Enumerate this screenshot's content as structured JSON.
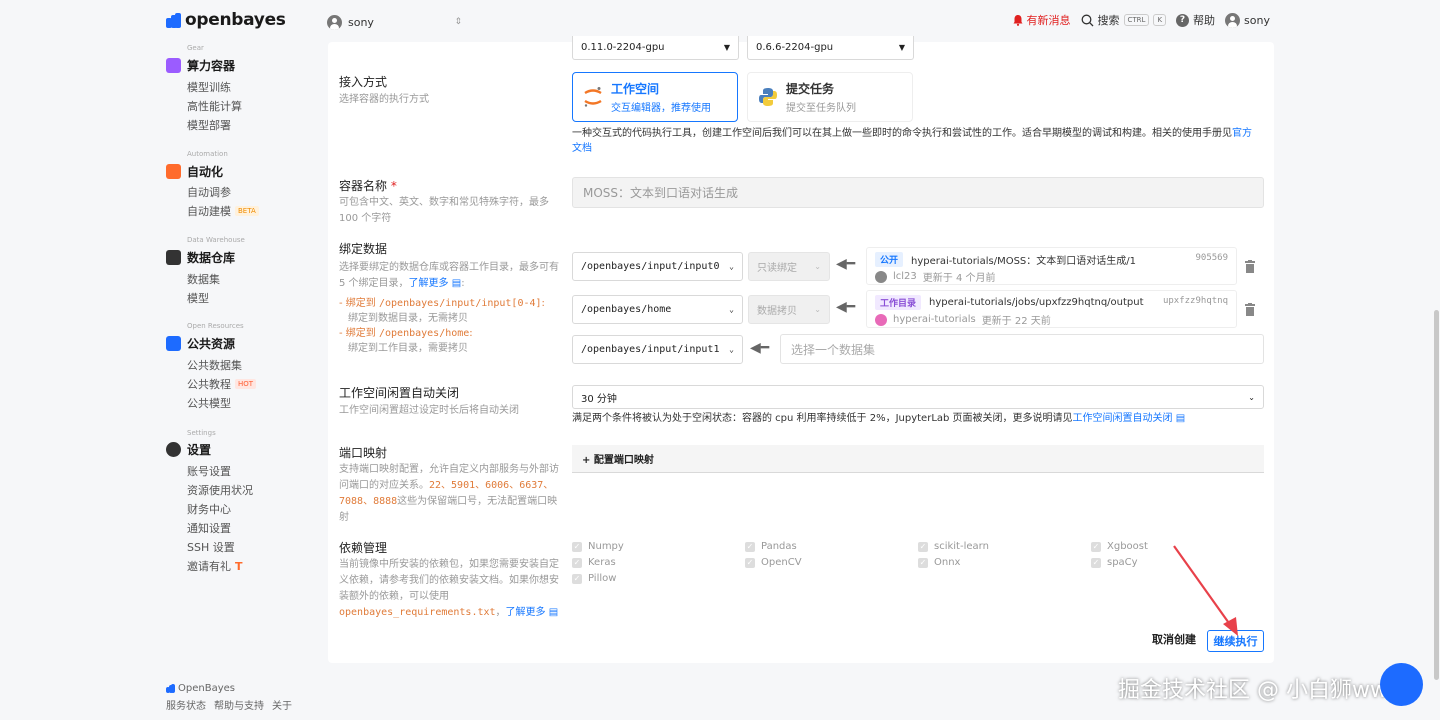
{
  "header": {
    "brand": "openbayes",
    "account": "sony",
    "notice": "有新消息",
    "search": "搜索",
    "kbd_ctrl": "CTRL",
    "kbd_k": "K",
    "help": "帮助",
    "user": "sony"
  },
  "sidebar": {
    "sections": [
      {
        "en": "Gear",
        "title": "算力容器",
        "items": [
          "模型训练",
          "高性能计算",
          "模型部署"
        ],
        "color": "#9b5cff"
      },
      {
        "en": "Automation",
        "title": "自动化",
        "items": [
          "自动调参",
          "自动建模"
        ],
        "badge": "BETA",
        "color": "#ff6b2c"
      },
      {
        "en": "Data Warehouse",
        "title": "数据仓库",
        "items": [
          "数据集",
          "模型"
        ],
        "color": "#333333"
      },
      {
        "en": "Open Resources",
        "title": "公共资源",
        "items": [
          "公共数据集",
          "公共教程",
          "公共模型"
        ],
        "badge": "HOT",
        "color": "#1d6bff"
      },
      {
        "en": "Settings",
        "title": "设置",
        "items": [
          "账号设置",
          "资源使用状况",
          "财务中心",
          "通知设置",
          "SSH 设置",
          "邀请有礼"
        ],
        "color": "#333333"
      }
    ]
  },
  "footer": {
    "brand": "OpenBayes",
    "links": [
      "服务状态",
      "帮助与支持",
      "关于"
    ]
  },
  "form": {
    "versions": [
      "0.11.0-2204-gpu",
      "0.6.6-2204-gpu"
    ],
    "access": {
      "label": "接入方式",
      "desc": "选择容器的执行方式",
      "workspace_title": "工作空间",
      "workspace_sub": "交互编辑器，推荐使用",
      "task_title": "提交任务",
      "task_sub": "提交至任务队列",
      "note": "一种交互式的代码执行工具，创建工作空间后我们可以在其上做一些即时的命令执行和尝试性的工作。适合早期模型的调试和构建。相关的使用手册见",
      "note_link_1": "官方",
      "note_link_2": "文档"
    },
    "name": {
      "label": "容器名称",
      "required": "*",
      "desc_1": "可包含中文、英文、数字和常见特殊字符，最多",
      "desc_2": "100 个字符",
      "value": "MOSS：文本到口语对话生成"
    },
    "bind": {
      "label": "绑定数据",
      "desc_1": "选择要绑定的数据仓库或容器工作目录，最多可有",
      "desc_2": "5 个绑定目录，",
      "learn_more": "了解更多",
      "hint1_prefix": "- 绑定到",
      "hint1_path": "/openbayes/input/input[0-4]",
      "hint1_colon": ":",
      "hint1_desc": "绑定到数据目录，无需拷贝",
      "hint2_prefix": "- 绑定到",
      "hint2_path": "/openbayes/home",
      "hint2_colon": ":",
      "hint2_desc": "绑定到工作目录，需要拷贝",
      "rows": [
        {
          "path": "/openbayes/input/input0",
          "mode": "只读绑定",
          "badge": "公开",
          "name": "hyperai-tutorials/MOSS：文本到口语对话生成/1",
          "hash": "905569",
          "owner": "lcl23",
          "updated": "更新于 4 个月前"
        },
        {
          "path": "/openbayes/home",
          "mode": "数据拷贝",
          "badge": "工作目录",
          "name": "hyperai-tutorials/jobs/upxfzz9hqtnq/output",
          "hash": "upxfzz9hqtnq",
          "owner": "hyperai-tutorials",
          "updated": "更新于 22 天前"
        },
        {
          "path": "/openbayes/input/input1",
          "placeholder": "选择一个数据集"
        }
      ]
    },
    "idle": {
      "label": "工作空间闲置自动关闭",
      "desc": "工作空间闲置超过设定时长后将自动关闭",
      "value": "30 分钟",
      "note": "满足两个条件将被认为处于空闲状态：容器的 cpu 利用率持续低于 2%，JupyterLab 页面被关闭，更多说明请见",
      "note_link": "工作空间闲置自动关闭"
    },
    "ports": {
      "label": "端口映射",
      "desc_1": "支持端口映射配置，允许自定义内部服务与外部访",
      "desc_2": "问端口的对应关系。",
      "ports_a": "22、5901、6006、6637、",
      "ports_b": "7088、8888",
      "desc_3": "这些为保留端口号，无法配置端口映",
      "desc_4": "射",
      "button": "+ 配置端口映射"
    },
    "deps": {
      "label": "依赖管理",
      "desc_1": "当前镜像中所安装的依赖包，如果您需要安装自定",
      "desc_2": "义依赖，请参考我们的依赖安装文档。如果你想安",
      "desc_3": "装额外的依赖，可以使用",
      "file": "openbayes_requirements.txt",
      "sep": "，",
      "learn_more": "了解更多",
      "packages": [
        "Numpy",
        "Pandas",
        "scikit-learn",
        "Xgboost",
        "Keras",
        "OpenCV",
        "Onnx",
        "spaCy",
        "Pillow"
      ]
    },
    "actions": {
      "cancel": "取消创建",
      "continue": "继续执行"
    }
  },
  "watermark": "掘金技术社区 @ 小白狮ww",
  "colors": {
    "accent": "#1677ff",
    "danger": "#e02020",
    "annotation_arrow": "#e8414a"
  }
}
